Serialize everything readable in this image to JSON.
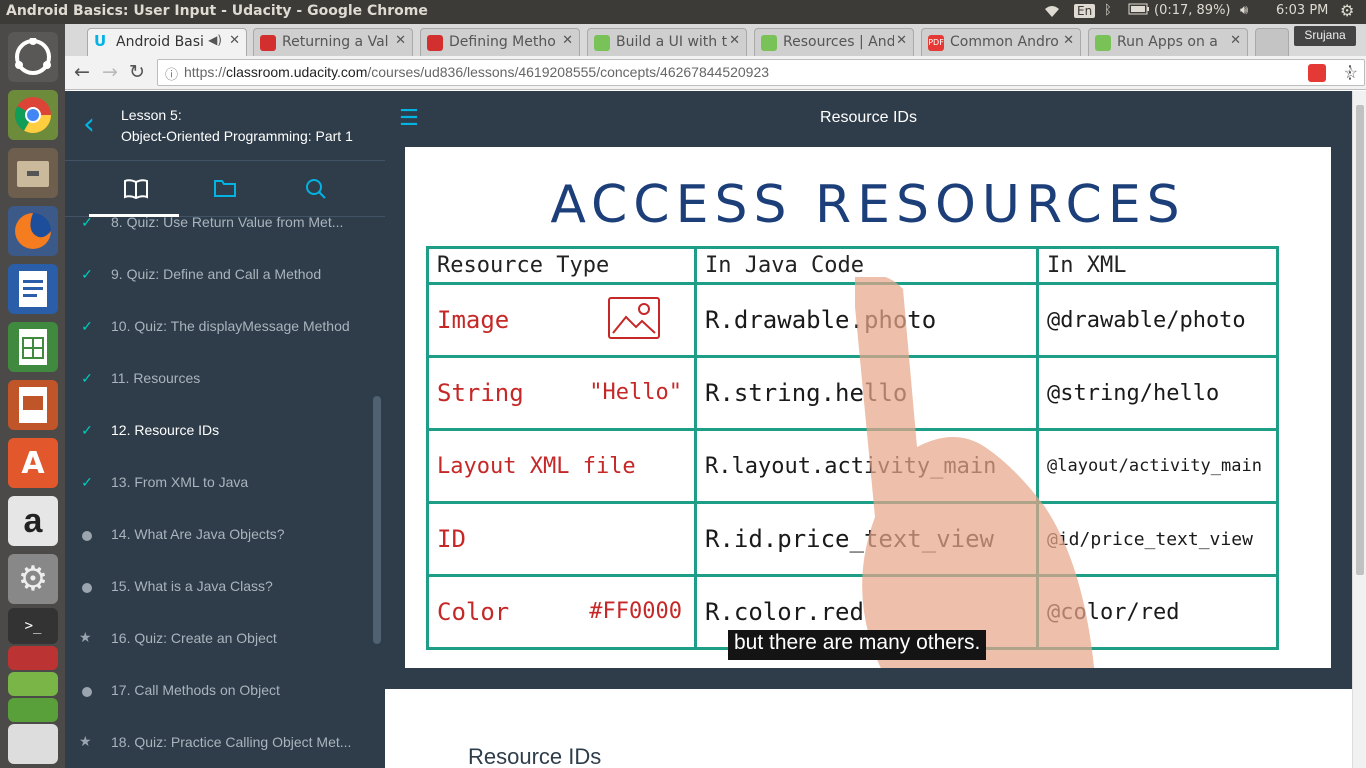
{
  "window": {
    "title": "Android Basics: User Input - Udacity - Google Chrome"
  },
  "indicators": {
    "lang": "En",
    "battery": "(0:17, 89%)",
    "time": "6:03 PM"
  },
  "tabs": [
    {
      "label": "Android Basi",
      "active": true,
      "favicon_color": "#02b3e4"
    },
    {
      "label": "Returning a Val",
      "active": false,
      "favicon_color": "#d32f2f"
    },
    {
      "label": "Defining Metho",
      "active": false,
      "favicon_color": "#d32f2f"
    },
    {
      "label": "Build a UI with t",
      "active": false,
      "favicon_color": "#78c257"
    },
    {
      "label": "Resources | And",
      "active": false,
      "favicon_color": "#78c257"
    },
    {
      "label": "Common Andro",
      "active": false,
      "favicon_color": "#e53935"
    },
    {
      "label": "Run Apps on a",
      "active": false,
      "favicon_color": "#78c257"
    }
  ],
  "profile": "Srujana",
  "url": {
    "prefix": "https://",
    "domain": "classroom.udacity.com",
    "path": "/courses/ud836/lessons/4619208555/concepts/46267844520923"
  },
  "lesson": {
    "line1": "Lesson 5:",
    "line2": "Object-Oriented Programming: Part 1"
  },
  "concepts": [
    {
      "label": "8. Quiz: Use Return Value from Met...",
      "status": "done"
    },
    {
      "label": "9. Quiz: Define and Call a Method",
      "status": "done"
    },
    {
      "label": "10. Quiz: The displayMessage Method",
      "status": "done"
    },
    {
      "label": "11. Resources",
      "status": "done"
    },
    {
      "label": "12. Resource IDs",
      "status": "current"
    },
    {
      "label": "13. From XML to Java",
      "status": "done"
    },
    {
      "label": "14. What Are Java Objects?",
      "status": "todo"
    },
    {
      "label": "15. What is a Java Class?",
      "status": "todo"
    },
    {
      "label": "16. Quiz: Create an Object",
      "status": "quiz"
    },
    {
      "label": "17. Call Methods on Object",
      "status": "todo"
    },
    {
      "label": "18. Quiz: Practice Calling Object Met...",
      "status": "quiz"
    }
  ],
  "main": {
    "title": "Resource IDs",
    "section_heading": "Resource IDs"
  },
  "video": {
    "title": "ACCESS RESOURCES",
    "headers": [
      "Resource Type",
      "In Java Code",
      "In XML"
    ],
    "rows": [
      {
        "type": "Image",
        "extra": "",
        "java": "R.drawable.photo",
        "xml": "@drawable/photo"
      },
      {
        "type": "String",
        "extra": "\"Hello\"",
        "java": "R.string.hello",
        "xml": "@string/hello"
      },
      {
        "type": "Layout XML file",
        "extra": "",
        "java": "R.layout.activity_main",
        "xml": "@layout/activity_main"
      },
      {
        "type": "ID",
        "extra": "",
        "java": "R.id.price_text_view",
        "xml": "@id/price_text_view"
      },
      {
        "type": "Color",
        "extra": "#FF0000",
        "java": "R.color.red",
        "xml": "@color/red"
      }
    ],
    "caption": "but there are many others."
  }
}
